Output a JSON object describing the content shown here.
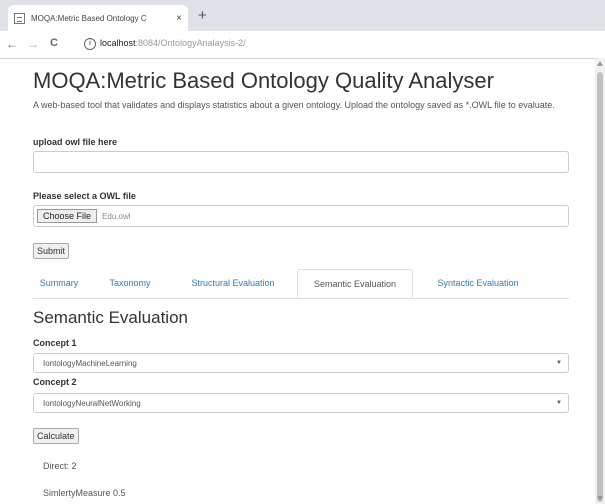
{
  "browser": {
    "tab_title": "MOQA:Metric Based Ontology C",
    "tab_close": "×",
    "new_tab": "+",
    "back": "←",
    "forward": "→",
    "reload": "C",
    "url_host": "localhost",
    "url_rest": ":8084/OntologyAnalaysis-2/"
  },
  "page": {
    "title": "MOQA:Metric Based Ontology Quality Analyser",
    "description": "A web-based tool that validates and displays statistics about a given ontology. Upload the ontology saved as *.OWL file to evaluate."
  },
  "upload": {
    "label": "upload owl file here",
    "value": ""
  },
  "file": {
    "label": "Please select a OWL file",
    "button": "Choose File",
    "filename": "Edu.owl"
  },
  "submit_label": "Submit",
  "tabs": [
    {
      "label": "Summary"
    },
    {
      "label": "Taxonomy"
    },
    {
      "label": "Structural Evaluation"
    },
    {
      "label": "Semantic Evaluation"
    },
    {
      "label": "Syntactic Evaluation"
    }
  ],
  "active_tab": "Semantic Evaluation",
  "semantic": {
    "heading": "Semantic Evaluation",
    "concept1_label": "Concept 1",
    "concept1_value": "IontologyMachineLearning",
    "concept2_label": "Concept 2",
    "concept2_value": "IontologyNeuralNetWorking",
    "calculate_label": "Calculate",
    "direct": "Direct: 2",
    "similarity": "SimlertyMeasure 0.5"
  },
  "colors": {
    "link": "#337ab7",
    "tabbar": "#dee1e6"
  }
}
